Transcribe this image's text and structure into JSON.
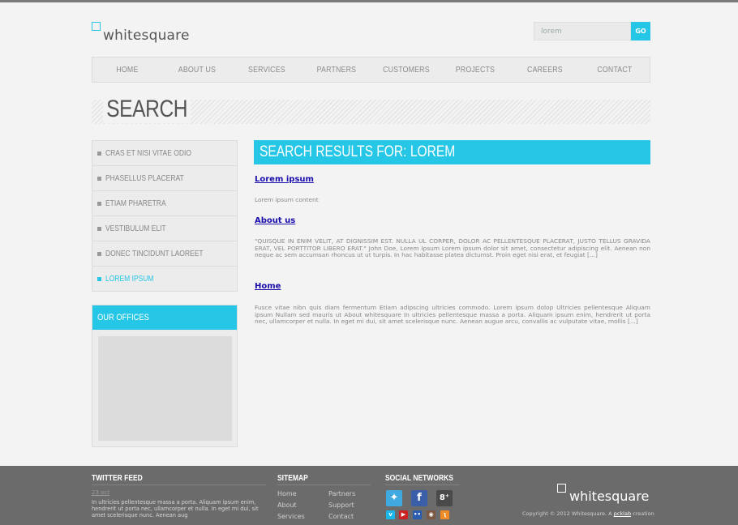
{
  "brand": {
    "name": "whitesquare",
    "accent_color": "#26c6e6"
  },
  "search": {
    "value": "lorem",
    "button": "GO"
  },
  "nav": {
    "items": [
      "HOME",
      "ABOUT US",
      "SERVICES",
      "PARTNERS",
      "CUSTOMERS",
      "PROJECTS",
      "CAREERS",
      "CONTACT"
    ]
  },
  "page": {
    "title": "SEARCH"
  },
  "sidebar": {
    "items": [
      {
        "label": "CRAS ET NISI VITAE ODIO",
        "active": false
      },
      {
        "label": "PHASELLUS PLACERAT",
        "active": false
      },
      {
        "label": "ETIAM PHARETRA",
        "active": false
      },
      {
        "label": "VESTIBULUM ELIT",
        "active": false
      },
      {
        "label": "DONEC TINCIDUNT LAOREET",
        "active": false
      },
      {
        "label": "LOREM IPSUM",
        "active": true
      }
    ],
    "offices_title": "OUR OFFICES"
  },
  "results": {
    "heading": "SEARCH RESULTS FOR: LOREM",
    "items": [
      {
        "title": "Lorem ipsum",
        "text": "Lorem ipsum content"
      },
      {
        "title": "About us",
        "text": "\"QUISQUE IN ENIM VELIT, AT DIGNISSIM EST. NULLA UL CORPER, DOLOR AC PELLENTESQUE PLACERAT, JUSTO TELLUS GRAVIDA ERAT, VEL PORTTITOR LIBERO ERAT.\" John Doe, Lorem Ipsum Lorem ipsum dolor sit amet, consectetur adipiscing elit. Aenean non neque ac sem accumsan rhoncus ut ut turpis. In hac habitasse platea dictumst. Proin eget nisi erat, et feugiat [...]"
      },
      {
        "title": "Home",
        "text": "Fusce vitae nibn quis diam fermentum Etiam adipscing ultricies commodo. Lorem ipsum dolop Ultricies pellentesque Aliquam ipsum Nullam sed mauris ut About whitesquare In ultricies pellentesque massa a porta. Aliquam ipsum enim, hendrerit ut porta nec, ullamcorper et nulla. In eget mi dui, sit amet scelerisque nunc. Aenean augue arcu, convallis ac vulputate vitae, mollis [...]"
      }
    ]
  },
  "footer": {
    "twitter": {
      "heading": "TWITTER FEED",
      "date": "23 oct",
      "text": "In ultricies pellentesque massa a porta. Aliquam ipsum enim, hendrerit ut porta nec, ullamcorper et nulla. In eget mi dui, sit amet scelerisque nunc. Aenean aug"
    },
    "sitemap": {
      "heading": "SITEMAP",
      "col1": [
        "Home",
        "About",
        "Services"
      ],
      "col2": [
        "Partners",
        "Support",
        "Contact"
      ]
    },
    "social": {
      "heading": "SOCIAL NETWORKS",
      "icons": [
        "twitter-icon",
        "facebook-icon",
        "google-plus-icon",
        "vimeo-icon",
        "youtube-icon",
        "flickr-icon",
        "instagram-icon",
        "rss-icon"
      ]
    },
    "logo": "whitesquare",
    "copyright": "Copyright © 2012 Whitesquare. A ",
    "copyright_link": "pcklab",
    "copyright_end": " creation"
  }
}
